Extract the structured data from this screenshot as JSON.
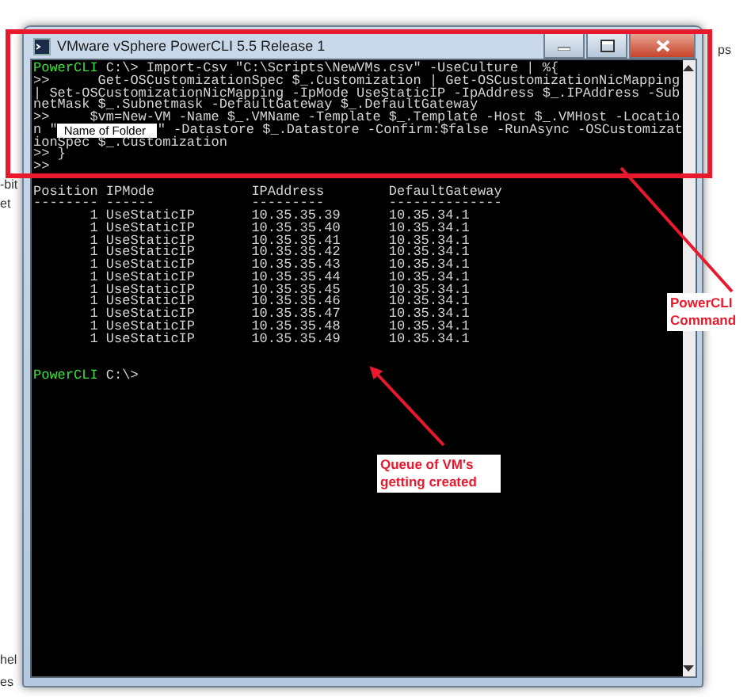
{
  "background_fragments": [
    {
      "text": "ps"
    },
    {
      "text": "-bit"
    },
    {
      "text": "et"
    },
    {
      "text": "hel"
    },
    {
      "text": "es"
    }
  ],
  "window": {
    "title": "VMware vSphere PowerCLI 5.5 Release 1"
  },
  "console": {
    "lines": [
      {
        "kind": "prompt",
        "prompt": "PowerCLI",
        "text": " C:\\> Import-Csv \"C:\\Scripts\\NewVMs.csv\" -UseCulture | %{"
      },
      {
        "kind": "text",
        "text": ">>      Get-OSCustomizationSpec $_.Customization | Get-OSCustomizationNicMapping"
      },
      {
        "kind": "text",
        "text": "| Set-OSCustomizationNicMapping -IpMode UseStaticIP -IpAddress $_.IPAddress -Sub"
      },
      {
        "kind": "text",
        "text": "netMask $_.Subnetmask -DefaultGateway $_.DefaultGateway"
      },
      {
        "kind": "text",
        "text": ">>     $vm=New-VM -Name $_.VMName -Template $_.Template -Host $_.VMHost -Locatio"
      },
      {
        "kind": "overlay",
        "before": "n \"",
        "label": "Name of Folder",
        "after": "\" -Datastore $_.Datastore -Confirm:$false -RunAsync -OSCustomizat"
      },
      {
        "kind": "text",
        "text": "ionSpec $_.Customization"
      },
      {
        "kind": "text",
        "text": ">> }"
      },
      {
        "kind": "text",
        "text": ">>"
      }
    ],
    "table": {
      "columns": [
        {
          "header": "Position",
          "rule": "--------"
        },
        {
          "header": "IPMode",
          "rule": "------"
        },
        {
          "header": "IPAddress",
          "rule": "---------"
        },
        {
          "header": "DefaultGateway",
          "rule": "--------------"
        }
      ],
      "rows": [
        [
          "1",
          "UseStaticIP",
          "10.35.35.39",
          "10.35.34.1"
        ],
        [
          "1",
          "UseStaticIP",
          "10.35.35.40",
          "10.35.34.1"
        ],
        [
          "1",
          "UseStaticIP",
          "10.35.35.41",
          "10.35.34.1"
        ],
        [
          "1",
          "UseStaticIP",
          "10.35.35.42",
          "10.35.34.1"
        ],
        [
          "1",
          "UseStaticIP",
          "10.35.35.43",
          "10.35.34.1"
        ],
        [
          "1",
          "UseStaticIP",
          "10.35.35.44",
          "10.35.34.1"
        ],
        [
          "1",
          "UseStaticIP",
          "10.35.35.45",
          "10.35.34.1"
        ],
        [
          "1",
          "UseStaticIP",
          "10.35.35.46",
          "10.35.34.1"
        ],
        [
          "1",
          "UseStaticIP",
          "10.35.35.47",
          "10.35.34.1"
        ],
        [
          "1",
          "UseStaticIP",
          "10.35.35.48",
          "10.35.34.1"
        ],
        [
          "1",
          "UseStaticIP",
          "10.35.35.49",
          "10.35.34.1"
        ]
      ]
    },
    "final_prompt": {
      "prompt": "PowerCLI",
      "text": " C:\\>"
    }
  },
  "annotations": [
    {
      "kind": "command",
      "text": "PowerCLI Command"
    },
    {
      "kind": "queue",
      "text": "Queue of VM's getting created"
    }
  ]
}
